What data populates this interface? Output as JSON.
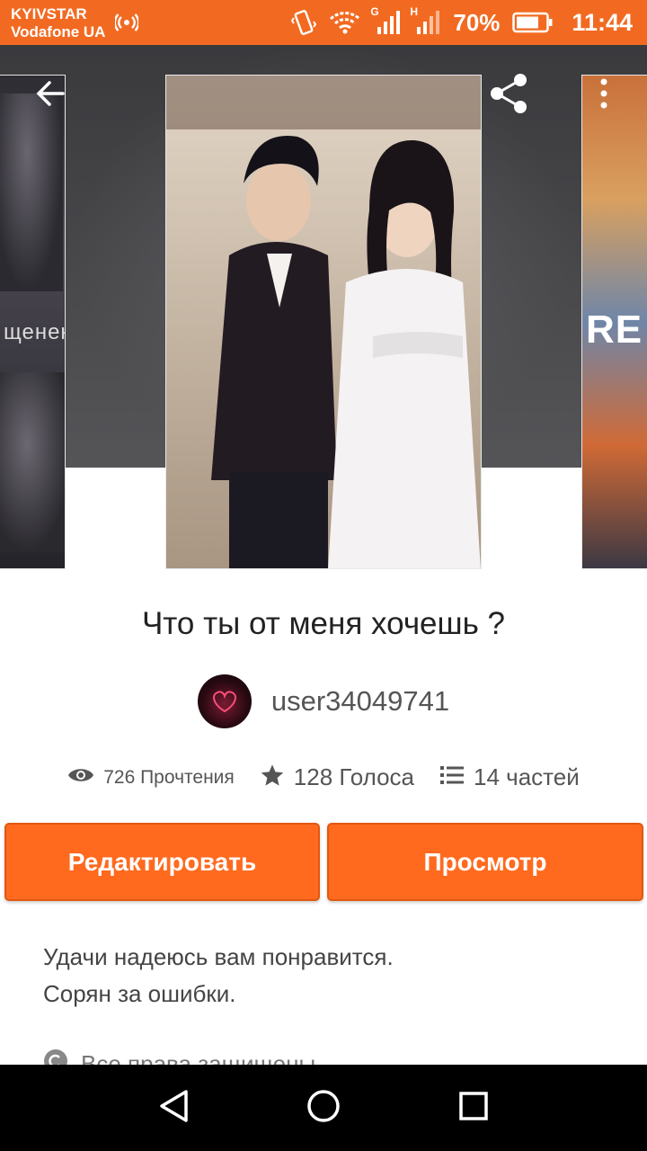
{
  "status_bar": {
    "carrier_1": "KYIVSTAR",
    "carrier_2": "Vodafone UA",
    "net_1": "G",
    "net_2": "H",
    "battery": "70%",
    "time": "11:44",
    "background": "#f26a21",
    "icons": [
      "hotspot-icon",
      "vibrate-icon",
      "wifi-icon",
      "signal-icon",
      "battery-icon"
    ]
  },
  "hero": {
    "left_cover_text": "щенен",
    "right_cover_text": "RE",
    "icons": [
      "back-arrow-icon",
      "share-icon",
      "more-vert-icon"
    ]
  },
  "story": {
    "title": "Что ты от меня хочешь ?",
    "author": "user34049741",
    "stats": {
      "reads": "726 Прочтения",
      "votes": "128 Голоса",
      "parts": "14 частей"
    },
    "description": [
      "Удачи надеюсь вам понравится.",
      "Сорян за ошибки."
    ],
    "rights": "Все права защищены"
  },
  "actions": {
    "edit_label": "Редактировать",
    "view_label": "Просмотр",
    "accent": "#ff6a1e"
  },
  "navbar": {
    "icons": [
      "back-triangle-icon",
      "home-circle-icon",
      "recents-square-icon"
    ]
  }
}
